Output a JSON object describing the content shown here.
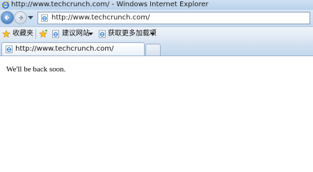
{
  "window": {
    "title": "http://www.techcrunch.com/ - Windows Internet Explorer"
  },
  "navigation": {
    "back_icon": "back-arrow-icon",
    "forward_icon": "forward-arrow-icon",
    "address": "http://www.techcrunch.com/"
  },
  "favorites_bar": {
    "favorites_label": "收藏夹",
    "items": [
      {
        "label": "建议网站",
        "icon": "ie-page-icon"
      },
      {
        "label": "获取更多加载项",
        "icon": "ie-page-icon"
      }
    ]
  },
  "tabs": [
    {
      "label": "http://www.techcrunch.com/"
    }
  ],
  "content": {
    "message": "We'll be back soon."
  },
  "colors": {
    "chrome_blue": "#c7daef",
    "accent": "#2f6db5"
  }
}
